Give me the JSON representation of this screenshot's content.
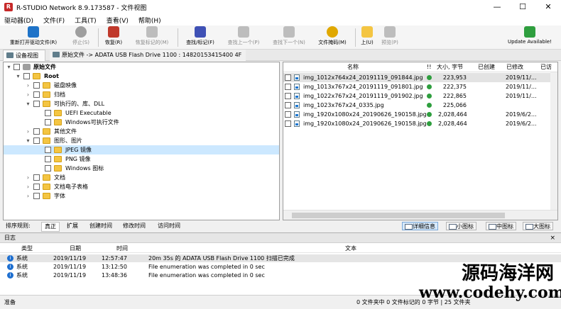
{
  "window": {
    "title": "R-STUDIO Network 8.9.173587 - 文件视图",
    "minimize": "—",
    "maximize": "☐",
    "close": "✕"
  },
  "menu": [
    "驱动器(D)",
    "文件(F)",
    "工具(T)",
    "查看(V)",
    "帮助(H)"
  ],
  "toolbar": [
    {
      "label": "重新打开驱动文件(R)",
      "icon": "refresh-icon",
      "color": "#1e73c8",
      "disabled": false
    },
    {
      "label": "停止(S)",
      "icon": "stop-icon",
      "color": "#9e9e9e",
      "disabled": true
    },
    {
      "label": "恢复(R)",
      "icon": "recover-icon",
      "color": "#c0392b",
      "disabled": false
    },
    {
      "label": "恢复标记的(M)",
      "icon": "recover-marked-icon",
      "color": "#bdbdbd",
      "disabled": true
    },
    {
      "label": "查找/标记(F)",
      "icon": "binoculars-icon",
      "color": "#3f51b5",
      "disabled": false
    },
    {
      "label": "查找上一个(P)",
      "icon": "find-prev-icon",
      "color": "#bdbdbd",
      "disabled": true
    },
    {
      "label": "查找下一个(N)",
      "icon": "find-next-icon",
      "color": "#bdbdbd",
      "disabled": true
    },
    {
      "label": "文件掩码(M)",
      "icon": "mask-icon",
      "color": "#e0a800",
      "disabled": false
    },
    {
      "label": "上(U)",
      "icon": "folder-up-icon",
      "color": "#f4c542",
      "disabled": false
    },
    {
      "label": "预览(P)",
      "icon": "preview-icon",
      "color": "#bdbdbd",
      "disabled": true
    },
    {
      "label": "Update Available!",
      "icon": "update-icon",
      "color": "#2e9e3e",
      "disabled": false
    }
  ],
  "tabs": [
    {
      "label": "设备视图"
    },
    {
      "label": "原始文件 -> ADATA USB Flash Drive 1100 : 14820153415400 4F"
    }
  ],
  "tree": [
    {
      "label": "原始文件",
      "expander": "▾",
      "checked": false,
      "kind": "drive",
      "bold": true
    },
    {
      "label": "Root",
      "expander": "▾",
      "checked": false,
      "kind": "folder",
      "bold": true
    },
    {
      "label": "磁盘映像",
      "expander": "›",
      "checked": false,
      "kind": "folder"
    },
    {
      "label": "归档",
      "expander": "›",
      "checked": false,
      "kind": "folder"
    },
    {
      "label": "可执行的、库、DLL",
      "expander": "▾",
      "checked": false,
      "kind": "folder"
    },
    {
      "label": "UEFI Executable",
      "expander": "",
      "checked": false,
      "kind": "folder"
    },
    {
      "label": "Windows可执行文件",
      "expander": "",
      "checked": false,
      "kind": "folder"
    },
    {
      "label": "其他文件",
      "expander": "›",
      "checked": false,
      "kind": "folder"
    },
    {
      "label": "图形、图片",
      "expander": "▾",
      "checked": false,
      "kind": "folder"
    },
    {
      "label": "JPEG 镜像",
      "expander": "",
      "checked": false,
      "kind": "folder",
      "selected": true
    },
    {
      "label": "PNG 镜像",
      "expander": "",
      "checked": false,
      "kind": "folder"
    },
    {
      "label": "Windows 图标",
      "expander": "",
      "checked": false,
      "kind": "folder"
    },
    {
      "label": "文档",
      "expander": "›",
      "checked": false,
      "kind": "folder"
    },
    {
      "label": "文档电子表格",
      "expander": "›",
      "checked": false,
      "kind": "folder"
    },
    {
      "label": "字体",
      "expander": "›",
      "checked": false,
      "kind": "folder"
    }
  ],
  "files": {
    "columns": {
      "name": "名称",
      "flag": "!!",
      "size": "大小, 字节",
      "created": "已创建",
      "modified": "已修改",
      "accessed": "已访"
    },
    "rows": [
      {
        "name": "img_1012x764x24_20191119_091844.jpg",
        "size": "223,953",
        "created": "",
        "modified": "2019/11/...",
        "selected": true
      },
      {
        "name": "img_1013x767x24_20191119_091801.jpg",
        "size": "222,375",
        "created": "",
        "modified": "2019/11/...",
        "selected": false
      },
      {
        "name": "img_1022x767x24_20191119_091902.jpg",
        "size": "222,865",
        "created": "",
        "modified": "2019/11/...",
        "selected": false
      },
      {
        "name": "img_1023x767x24_0335.jpg",
        "size": "225,066",
        "created": "",
        "modified": "",
        "selected": false
      },
      {
        "name": "img_1920x1080x24_20190626_190158.jpg",
        "size": "2,028,464",
        "created": "",
        "modified": "2019/6/2...",
        "selected": false
      },
      {
        "name": "img_1920x1080x24_20190626_190158.jpg",
        "size": "2,028,464",
        "created": "",
        "modified": "2019/6/2...",
        "selected": false
      }
    ]
  },
  "sort": {
    "label": "排序规则:",
    "options": [
      "真正",
      "扩展",
      "创建时间",
      "修改时间",
      "访问时间"
    ],
    "active": "真正"
  },
  "views": [
    {
      "label": "详细信息",
      "active": true
    },
    {
      "label": "小图标",
      "active": false
    },
    {
      "label": "中图标",
      "active": false
    },
    {
      "label": "大图标",
      "active": false
    }
  ],
  "log": {
    "title": "日志",
    "close": "×",
    "columns": {
      "type": "类型",
      "date": "日期",
      "time": "时间",
      "text": "文本"
    },
    "rows": [
      {
        "type": "系统",
        "date": "2019/11/19",
        "time": "12:57:47",
        "text": "20m 35s 的 ADATA USB Flash Drive 1100 扫描已完成",
        "selected": true
      },
      {
        "type": "系统",
        "date": "2019/11/19",
        "time": "13:12:50",
        "text": "File enumeration was completed in 0 sec",
        "selected": false
      },
      {
        "type": "系统",
        "date": "2019/11/19",
        "time": "13:48:36",
        "text": "File enumeration was completed in 0 sec",
        "selected": false
      }
    ]
  },
  "status": {
    "left": "准备",
    "right": "0 文件夹中 0 文件标记的 0 字节 | 25 文件夹"
  },
  "watermark": {
    "line1": "源码海洋网",
    "line2": "www.codehy.com"
  }
}
